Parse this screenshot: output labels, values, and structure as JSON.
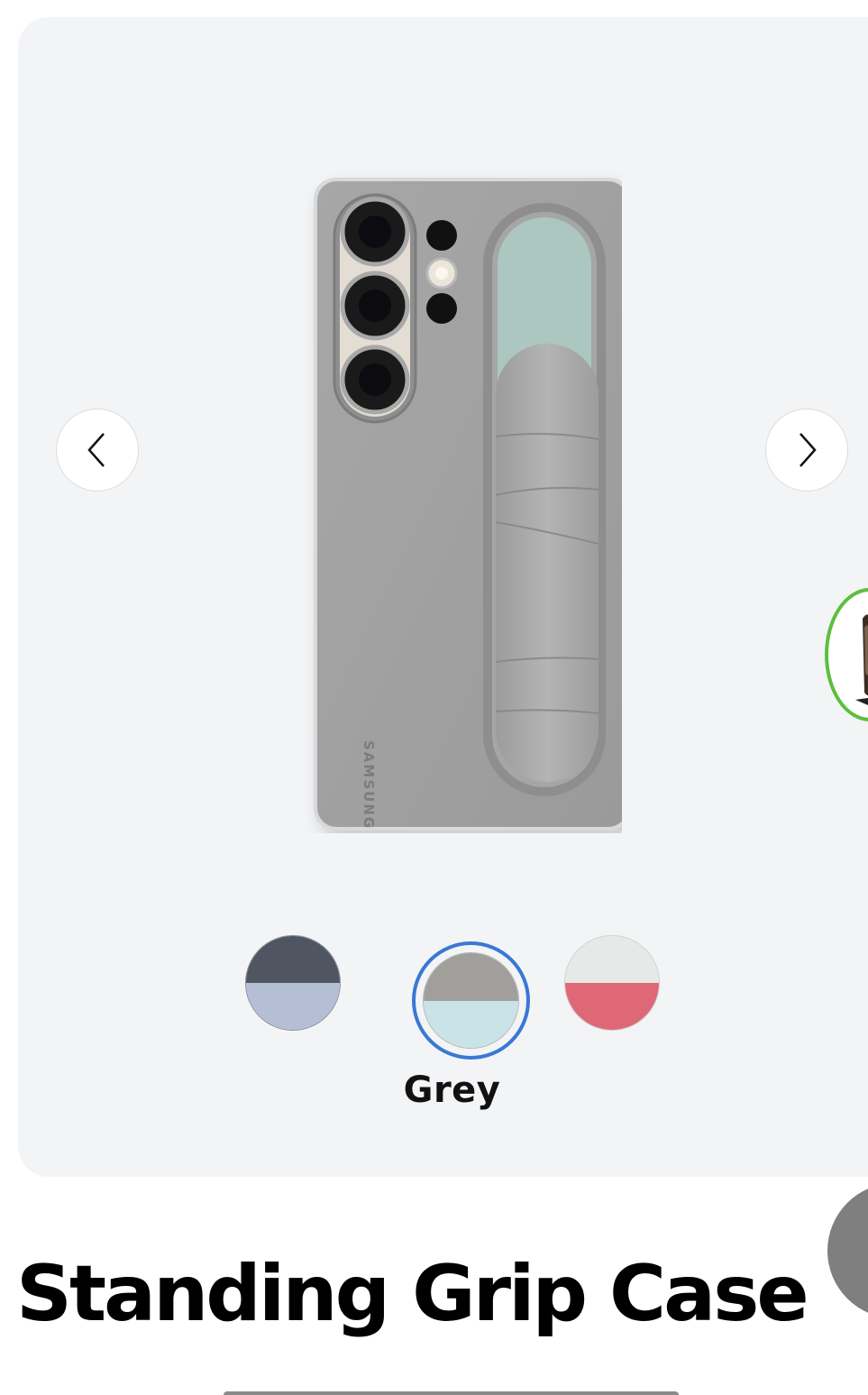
{
  "gallery": {
    "prev_icon": "chevron-left-icon",
    "next_icon": "chevron-right-icon",
    "phone_brand": "SAMSUNG"
  },
  "color_options": [
    {
      "name": "Dark Blue",
      "top_color": "#4f5561",
      "bottom_color": "#b4bfd6",
      "selected": false
    },
    {
      "name": "Grey",
      "top_color": "#a09f9c",
      "bottom_color": "#c9e3e6",
      "selected": true
    },
    {
      "name": "Pink",
      "top_color": "#e7e8e8",
      "bottom_color": "#df6877",
      "selected": false
    }
  ],
  "selected_color_label": "Grey",
  "product": {
    "title": "Standing Grip Case"
  },
  "colors": {
    "selected_ring": "#3a78d4",
    "thumbnail_ring": "#5cbf3e",
    "gallery_background": "#f3f4f6"
  }
}
